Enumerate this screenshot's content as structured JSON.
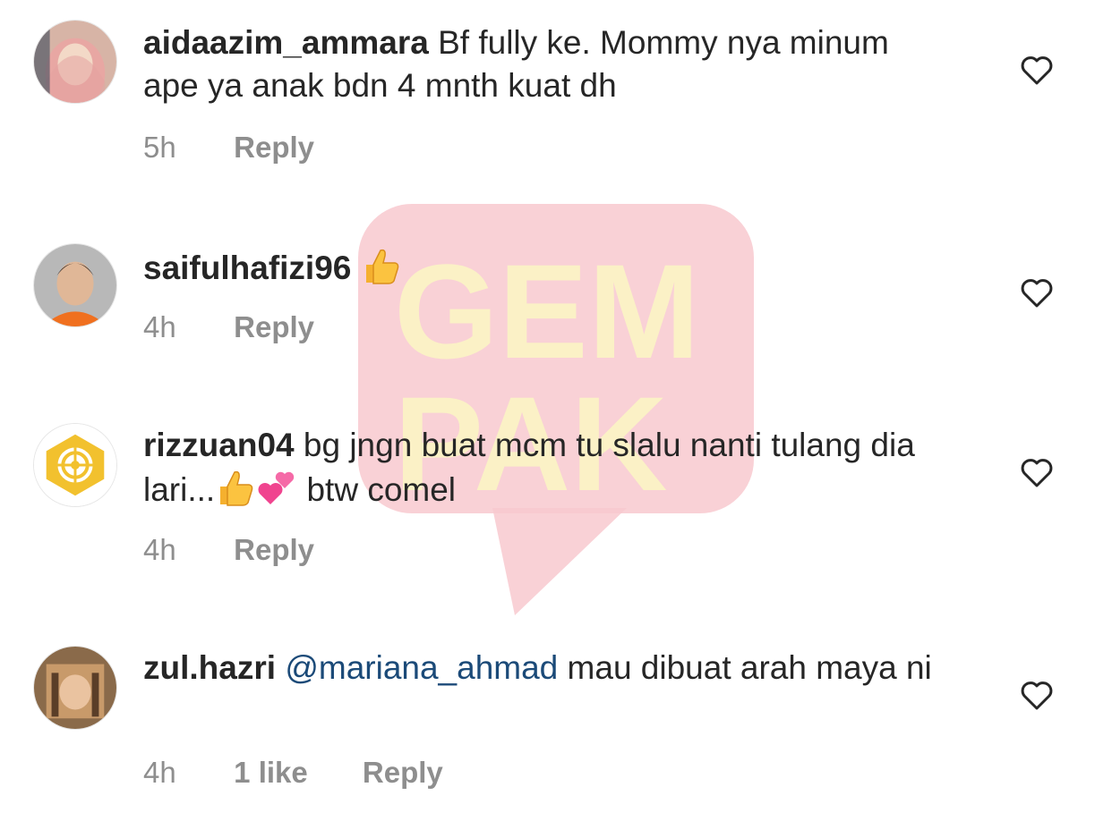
{
  "watermark": {
    "line1": "GEM",
    "line2": "PAK"
  },
  "comments": [
    {
      "username": "aidaazim_ammara",
      "text": "Bf fully ke. Mommy nya minum ape ya anak bdn 4 mnth kuat dh",
      "time": "5h",
      "reply": "Reply"
    },
    {
      "username": "saifulhafizi96",
      "text": "",
      "emoji": "thumbs-up",
      "time": "4h",
      "reply": "Reply"
    },
    {
      "username": "rizzuan04",
      "text_before": "bg jngn buat mcm tu slalu nanti tulang dia lari...",
      "text_after": "btw comel",
      "emojis": [
        "thumbs-up",
        "two-hearts"
      ],
      "time": "4h",
      "reply": "Reply"
    },
    {
      "username": "zul.hazri",
      "mention": "@mariana_ahmad",
      "text": "mau dibuat arah maya ni",
      "time": "4h",
      "likes": "1 like",
      "reply": "Reply"
    }
  ],
  "colors": {
    "username": "#262626",
    "meta": "#8e8e8e",
    "mention": "#1b4a78",
    "watermark_bg": "#f7c6cc",
    "watermark_text": "#fbf0c4"
  }
}
